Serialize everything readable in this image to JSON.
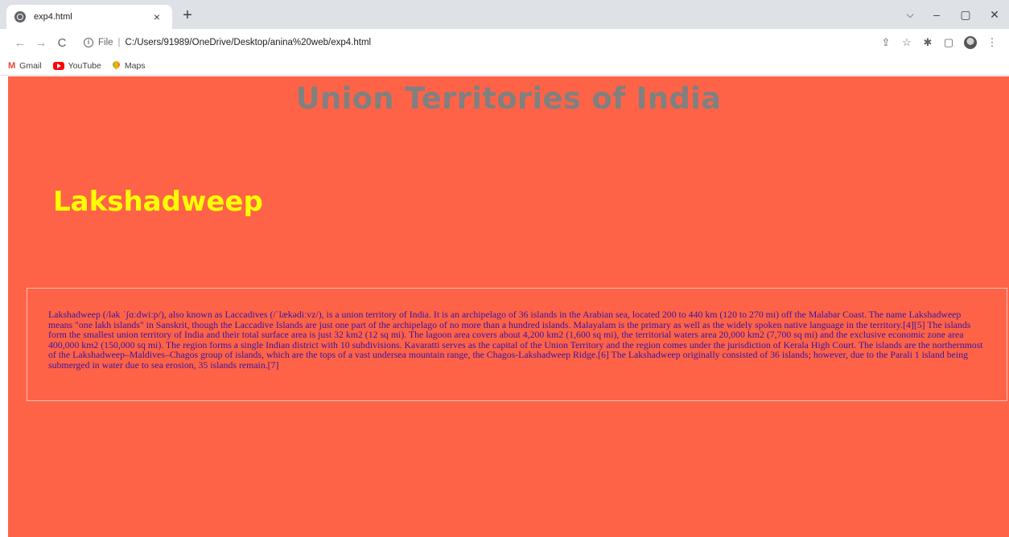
{
  "browser": {
    "tab_title": "exp4.html",
    "tab_close": "×",
    "new_tab": "+",
    "window_controls": {
      "dropdown": "⌵",
      "minimize": "–",
      "restore": "▢",
      "close": "✕"
    },
    "nav": {
      "back": "←",
      "forward": "→",
      "reload": "C"
    },
    "address_scheme": "File",
    "address_separator": "|",
    "address_path": "C:/Users/91989/OneDrive/Desktop/anina%20web/exp4.html",
    "toolbar_icons": [
      "share-icon",
      "star-icon",
      "extensions-icon",
      "sidepanel-icon",
      "profile-icon",
      "menu-icon"
    ],
    "bookmarks": [
      {
        "label": "Gmail",
        "icon": "gmail-icon"
      },
      {
        "label": "YouTube",
        "icon": "youtube-icon"
      },
      {
        "label": "Maps",
        "icon": "maps-icon"
      }
    ]
  },
  "page": {
    "background_color": "#ff6347",
    "title": "Union Territories of India",
    "title_color": "#808080",
    "heading": "Lakshadweep",
    "heading_color": "#ffff00",
    "paragraph": "Lakshadweep (/lək ˈʃɑːdwiːp/), also known as Laccadives (/ˈlækədiːvz/), is a union territory of India. It is an archipelago of 36 islands in the Arabian sea, located 200 to 440 km (120 to 270 mi) off the Malabar Coast. The name Lakshadweep means \"one lakh islands\" in Sanskrit, though the Laccadive Islands are just one part of the archipelago of no more than a hundred islands. Malayalam is the primary as well as the widely spoken native language in the territory.[4][5] The islands form the smallest union territory of India and their total surface area is just 32 km2 (12 sq mi). The lagoon area covers about 4,200 km2 (1,600 sq mi), the territorial waters area 20,000 km2 (7,700 sq mi) and the exclusive economic zone area 400,000 km2 (150,000 sq mi). The region forms a single Indian district with 10 subdivisions. Kavaratti serves as the capital of the Union Territory and the region comes under the jurisdiction of Kerala High Court. The islands are the northernmost of the Lakshadweep–Maldives–Chagos group of islands, which are the tops of a vast undersea mountain range, the Chagos-Lakshadweep Ridge.[6] The Lakshadweep originally consisted of 36 islands; however, due to the Parali 1 island being submerged in water due to sea erosion, 35 islands remain.[7]",
    "paragraph_color": "#3b14a0"
  }
}
